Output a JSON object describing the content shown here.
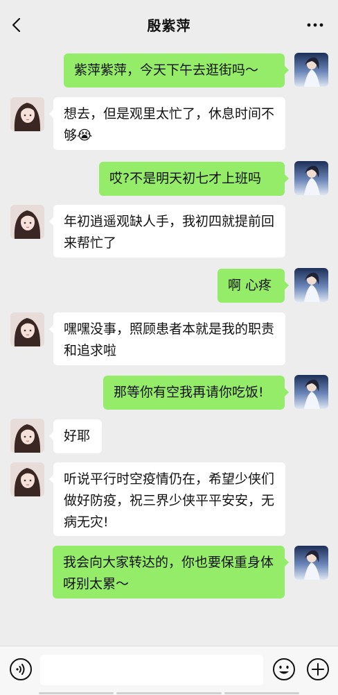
{
  "header": {
    "title": "殷紫萍",
    "back_icon": "chevron-left-icon",
    "more_icon": "more-dots-icon"
  },
  "messages": [
    {
      "side": "out",
      "text": "紫萍紫萍，今天下午去逛街吗～"
    },
    {
      "side": "in",
      "text": "想去，但是观里太忙了，休息时间不够😭"
    },
    {
      "side": "out",
      "text": "哎?不是明天初七才上班吗"
    },
    {
      "side": "in",
      "text": "年初逍遥观缺人手，我初四就提前回来帮忙了"
    },
    {
      "side": "out",
      "text": "啊 心疼"
    },
    {
      "side": "in",
      "text": "嘿嘿没事，照顾患者本就是我的职责和追求啦"
    },
    {
      "side": "out",
      "text": "那等你有空我再请你吃饭!"
    },
    {
      "side": "in",
      "text": "好耶"
    },
    {
      "side": "in",
      "text": "听说平行时空疫情仍在，希望少侠们做好防疫，祝三界少侠平平安安，无病无灾!"
    },
    {
      "side": "out",
      "text": "我会向大家转达的，你也要保重身体呀别太累～"
    }
  ],
  "input_bar": {
    "value": "",
    "voice_icon": "voice-icon",
    "emoji_icon": "emoji-icon",
    "plus_icon": "plus-icon"
  },
  "colors": {
    "background": "#ededed",
    "outgoing_bubble": "#95ec69",
    "incoming_bubble": "#ffffff"
  }
}
